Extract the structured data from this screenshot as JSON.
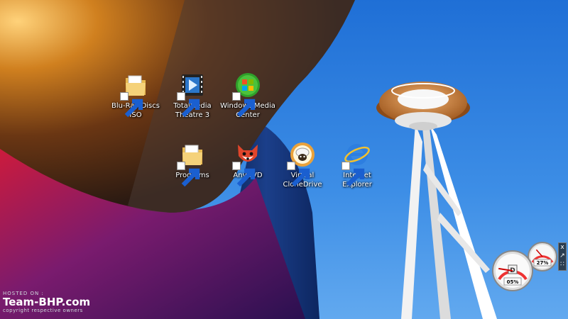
{
  "desktop_icons": [
    {
      "label": "Blu-Ray Discs\nISO",
      "icon": "folder-icon"
    },
    {
      "label": "TotalMedia\nTheatre 3",
      "icon": "totalmedia-film-icon"
    },
    {
      "label": "Windows Media\nCenter",
      "icon": "windows-media-center-icon"
    },
    {
      "label": "Programs",
      "icon": "folder-icon"
    },
    {
      "label": "AnyDVD",
      "icon": "anydvd-fox-icon"
    },
    {
      "label": "Virtual\nCloneDrive",
      "icon": "virtual-clonedrive-sheep-icon"
    },
    {
      "label": "Internet\nExplorer",
      "icon": "internet-explorer-icon"
    }
  ],
  "gadget": {
    "cpu_value": "05%",
    "memory_value": "27%",
    "cpu_fraction": 0.05,
    "memory_fraction": 0.27,
    "toolbar_close": "x",
    "toolbar_options": "↗",
    "toolbar_drag": "∷"
  },
  "watermark": {
    "hosted_on": "HOSTED ON :",
    "brand": "Team-BHP.com",
    "copyright": "copyright respective owners"
  }
}
